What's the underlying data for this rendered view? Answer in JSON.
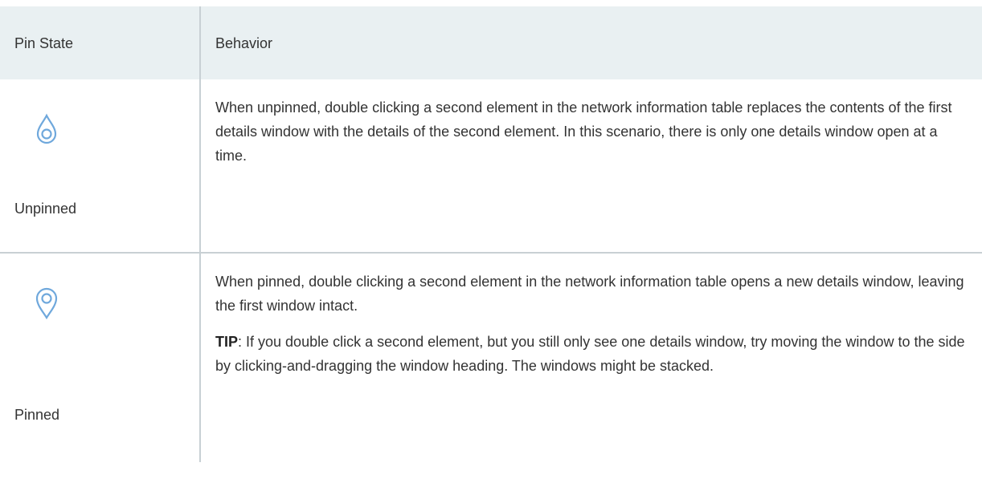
{
  "table": {
    "headers": {
      "pin_state": "Pin State",
      "behavior": "Behavior"
    },
    "rows": [
      {
        "icon": "unpinned-icon",
        "state": "Unpinned",
        "behavior": "When unpinned, double clicking a second element in the network information table replaces the contents of the first details window with the details of the second element. In this scenario, there is only one details window open at a time."
      },
      {
        "icon": "pinned-icon",
        "state": "Pinned",
        "behavior": "When pinned, double clicking a second element in the network information table opens a new details window, leaving the first window intact.",
        "tip_label": "TIP",
        "tip_text": ": If you double click a second element, but you still only see one details window, try moving the window to the side by clicking-and-dragging the window heading. The windows might be stacked."
      }
    ]
  },
  "colors": {
    "header_bg": "#e9f0f2",
    "divider": "#c8d0d4",
    "icon_stroke": "#6fa8dc"
  }
}
